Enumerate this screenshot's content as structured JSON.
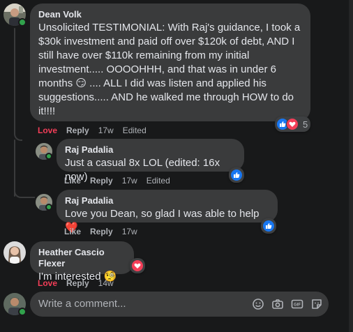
{
  "comments": [
    {
      "author": "Dean Volk",
      "lines": [
        "Unsolicited TESTIMONIAL: With Raj's guidance, I took a",
        "$30k investment and paid off over $120k of debt, AND I",
        "still have over $110k remaining from my initial",
        "investment..... OOOOHHH, and that was in under 6",
        "months 😏 .... ALL I did was listen and applied his",
        "suggestions..... AND he walked me through HOW to do",
        "it!!!!"
      ],
      "actions": {
        "reaction": "Love",
        "reply": "Reply",
        "time": "17w",
        "edited": "Edited"
      },
      "reaction_count": "5"
    },
    {
      "author": "Raj Padalia",
      "text": "Just a casual 8x LOL (edited: 16x now)",
      "actions": {
        "reaction": "Like",
        "reply": "Reply",
        "time": "17w",
        "edited": "Edited"
      }
    },
    {
      "author": "Raj Padalia",
      "text": "Love you Dean, so glad I was able to help ❤️",
      "actions": {
        "reaction": "Like",
        "reply": "Reply",
        "time": "17w"
      }
    },
    {
      "author": "Heather Cascio Flexer",
      "text": "I'm interested 🧐",
      "actions": {
        "reaction": "Love",
        "reply": "Reply",
        "time": "14w"
      }
    }
  ],
  "composer": {
    "placeholder": "Write a comment...",
    "icons": [
      "emoji-icon",
      "camera-icon",
      "gif-icon",
      "sticker-icon"
    ]
  },
  "colors": {
    "background": "#18191a",
    "bubble": "#3a3b3c",
    "love": "#f33e58",
    "like": "#1877f2",
    "online": "#31a24c"
  }
}
